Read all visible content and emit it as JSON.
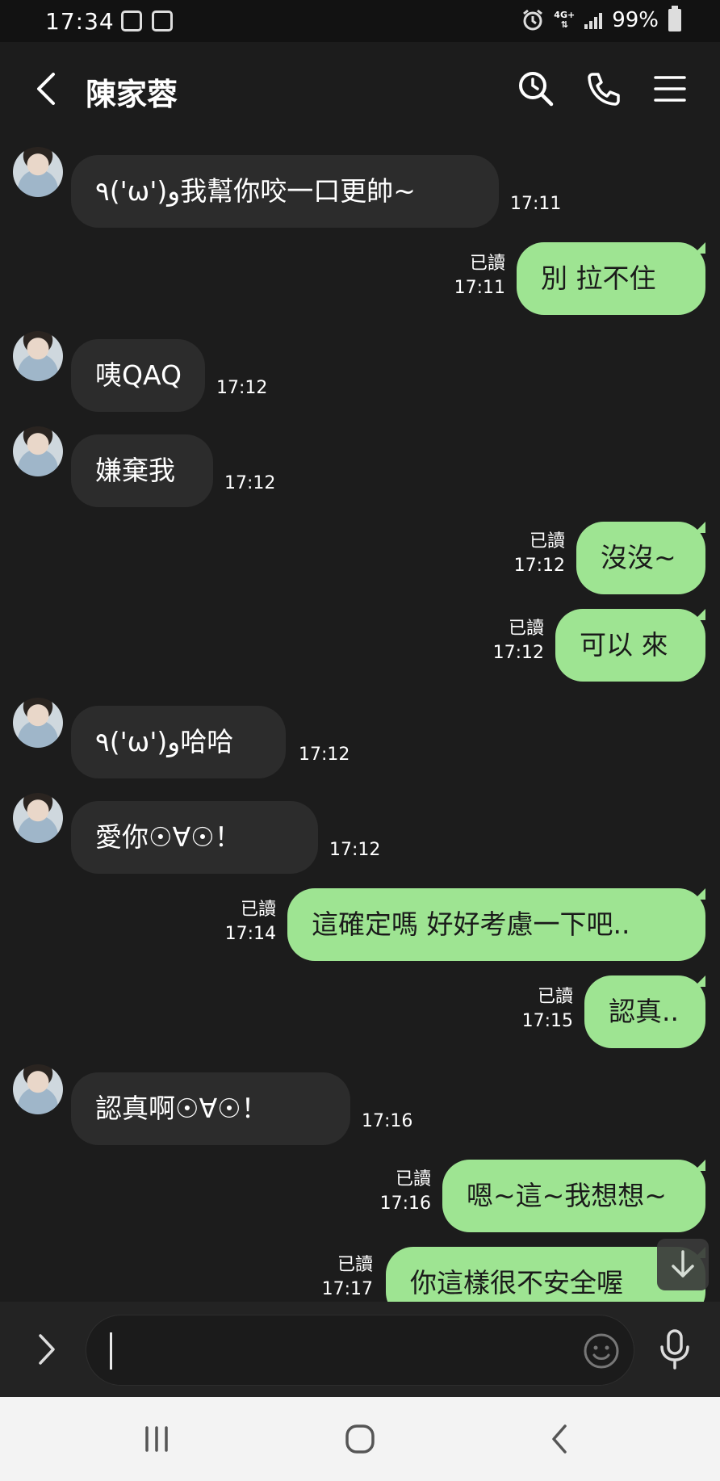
{
  "status_bar": {
    "time": "17:34",
    "network": "4G+",
    "battery": "99%"
  },
  "header": {
    "contact_name": "陳家蓉"
  },
  "messages": [
    {
      "side": "in",
      "text": "٩('ω')و我幫你咬一口更帥~",
      "time": "17:11"
    },
    {
      "side": "out",
      "text": "別 拉不住",
      "read": "已讀",
      "time": "17:11"
    },
    {
      "side": "in",
      "text": "咦QAQ",
      "time": "17:12"
    },
    {
      "side": "in",
      "text": "嫌棄我",
      "time": "17:12"
    },
    {
      "side": "out",
      "text": "沒沒~",
      "read": "已讀",
      "time": "17:12"
    },
    {
      "side": "out",
      "text": "可以 來",
      "read": "已讀",
      "time": "17:12"
    },
    {
      "side": "in",
      "text": "٩('ω')و哈哈",
      "time": "17:12"
    },
    {
      "side": "in",
      "text": "愛你☉∀☉！",
      "time": "17:12"
    },
    {
      "side": "out",
      "text": "這確定嗎 好好考慮一下吧..",
      "read": "已讀",
      "time": "17:14"
    },
    {
      "side": "out",
      "text": "認真..",
      "read": "已讀",
      "time": "17:15"
    },
    {
      "side": "in",
      "text": "認真啊☉∀☉！",
      "time": "17:16"
    },
    {
      "side": "out",
      "text": "嗯~這~我想想~",
      "read": "已讀",
      "time": "17:16"
    },
    {
      "side": "out",
      "text": "你這樣很不安全喔",
      "read": "已讀",
      "time": "17:17"
    }
  ],
  "input": {
    "value": ""
  },
  "colors": {
    "background": "#1c1c1c",
    "incoming_bubble": "#2c2c2c",
    "outgoing_bubble": "#9ee492"
  }
}
